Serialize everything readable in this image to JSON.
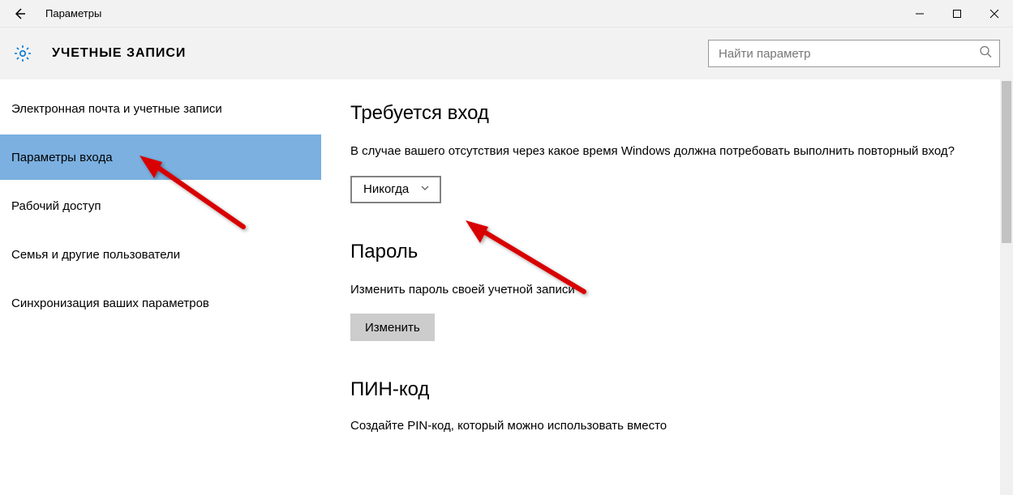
{
  "window": {
    "title": "Параметры"
  },
  "header": {
    "heading": "УЧЕТНЫЕ ЗАПИСИ",
    "search_placeholder": "Найти параметр"
  },
  "sidebar": {
    "items": [
      {
        "label": "Электронная почта и учетные записи",
        "selected": false
      },
      {
        "label": "Параметры входа",
        "selected": true
      },
      {
        "label": "Рабочий доступ",
        "selected": false
      },
      {
        "label": "Семья и другие пользователи",
        "selected": false
      },
      {
        "label": "Синхронизация ваших параметров",
        "selected": false
      }
    ]
  },
  "content": {
    "signin_required": {
      "title": "Требуется вход",
      "question": "В случае вашего отсутствия через какое время Windows должна потребовать выполнить повторный вход?",
      "dropdown_value": "Никогда"
    },
    "password": {
      "title": "Пароль",
      "description": "Изменить пароль своей учетной записи",
      "button": "Изменить"
    },
    "pin": {
      "title": "ПИН-код",
      "partial": "Создайте PIN-код, который можно использовать вместо"
    }
  }
}
